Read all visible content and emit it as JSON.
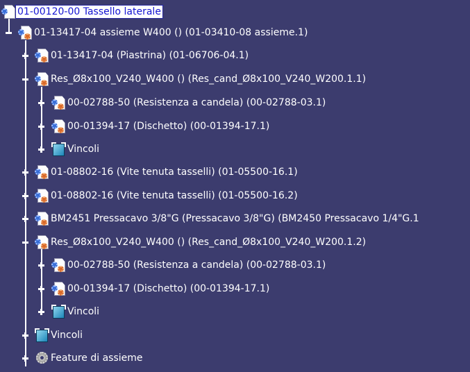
{
  "tree": {
    "root": {
      "label": "01-00120-00 Tassello laterale",
      "icon": "part-document-icon",
      "selected": true
    },
    "nodes": [
      {
        "label": "01-13417-04 assieme W400   ()   (01-03410-08 assieme.1)",
        "icon": "product-icon",
        "expanded": true
      },
      {
        "label": "01-13417-04   (Piastrina)   (01-06706-04.1)",
        "icon": "product-icon",
        "expanded": false
      },
      {
        "label": "Res_Ø8x100_V240_W400   ()   (Res_cand_Ø8x100_V240_W200.1.1)",
        "icon": "product-icon",
        "expanded": true
      },
      {
        "label": "00-02788-50   (Resistenza a candela)   (00-02788-03.1)",
        "icon": "part-icon",
        "expanded": false
      },
      {
        "label": "00-01394-17   (Dischetto)   (00-01394-17.1)",
        "icon": "part-icon",
        "expanded": false
      },
      {
        "label": "Vincoli",
        "icon": "constraints-icon",
        "expanded": false
      },
      {
        "label": "01-08802-16   (Vite tenuta tasselli)   (01-05500-16.1)",
        "icon": "product-icon",
        "expanded": false
      },
      {
        "label": "01-08802-16   (Vite tenuta tasselli)   (01-05500-16.2)",
        "icon": "product-icon",
        "expanded": false
      },
      {
        "label": "BM2451 Pressacavo 3/8\"G   (Pressacavo 3/8\"G)   (BM2450 Pressacavo 1/4\"G.1",
        "icon": "product-icon",
        "expanded": false
      },
      {
        "label": "Res_Ø8x100_V240_W400   ()   (Res_cand_Ø8x100_V240_W200.1.2)",
        "icon": "product-icon",
        "expanded": true
      },
      {
        "label": "00-02788-50   (Resistenza a candela)   (00-02788-03.1)",
        "icon": "part-icon",
        "expanded": false
      },
      {
        "label": "00-01394-17   (Dischetto)   (00-01394-17.1)",
        "icon": "part-icon",
        "expanded": false
      },
      {
        "label": "Vincoli",
        "icon": "constraints-icon",
        "expanded": false
      },
      {
        "label": "Vincoli",
        "icon": "constraints-icon",
        "expanded": false
      },
      {
        "label": "Feature di assieme",
        "icon": "assembly-feature-gear-icon",
        "expanded": false
      }
    ]
  },
  "colors": {
    "background": "#3c3c6e",
    "text": "#ffffff",
    "selection_bg": "#ffffff",
    "selection_text": "#1414d2"
  }
}
